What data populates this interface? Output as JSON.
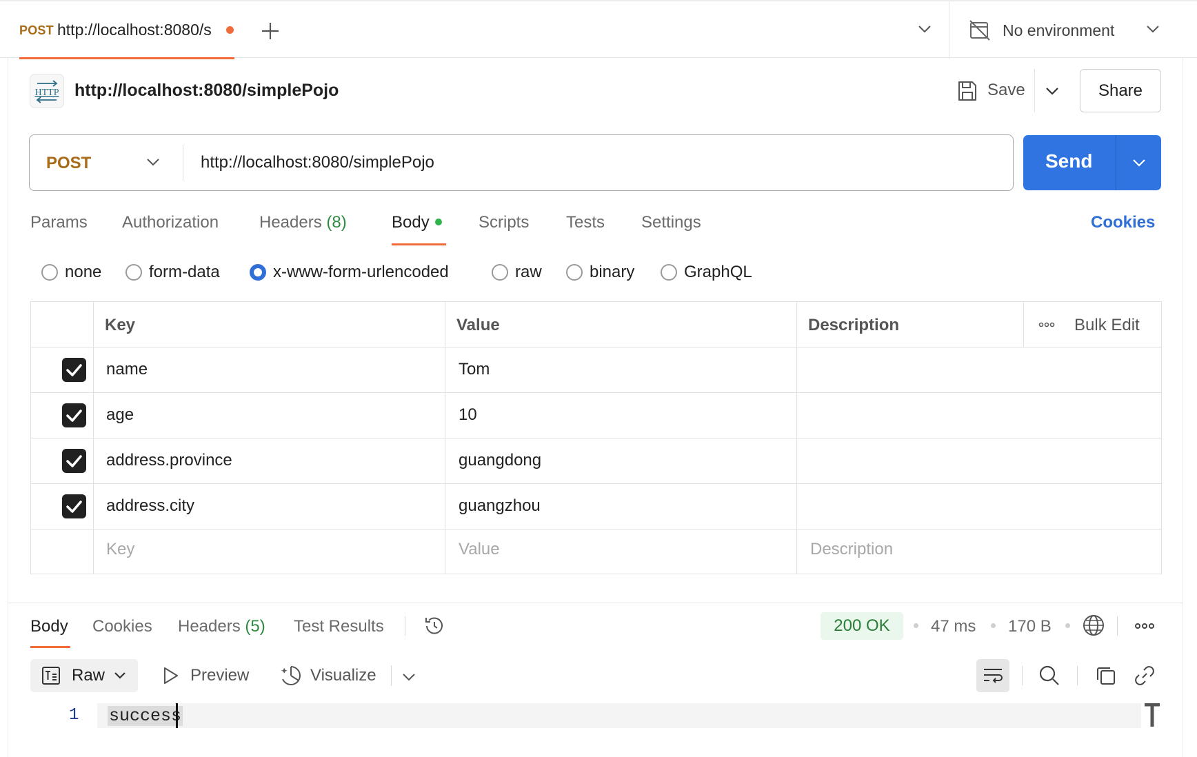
{
  "top_tab": {
    "method": "POST",
    "url": "http://localhost:8080/s",
    "environment": "No environment"
  },
  "request": {
    "title": "http://localhost:8080/simplePojo",
    "save_label": "Save",
    "share_label": "Share",
    "method": "POST",
    "url": "http://localhost:8080/simplePojo",
    "send_label": "Send"
  },
  "request_tabs": [
    {
      "label": "Params",
      "count": ""
    },
    {
      "label": "Authorization",
      "count": ""
    },
    {
      "label": "Headers",
      "count": "(8)"
    },
    {
      "label": "Body",
      "count": ""
    },
    {
      "label": "Scripts",
      "count": ""
    },
    {
      "label": "Tests",
      "count": ""
    },
    {
      "label": "Settings",
      "count": ""
    }
  ],
  "cookies_link": "Cookies",
  "body_types": [
    {
      "label": "none",
      "selected": false
    },
    {
      "label": "form-data",
      "selected": false
    },
    {
      "label": "x-www-form-urlencoded",
      "selected": true
    },
    {
      "label": "raw",
      "selected": false
    },
    {
      "label": "binary",
      "selected": false
    },
    {
      "label": "GraphQL",
      "selected": false
    }
  ],
  "table": {
    "headers": {
      "key": "Key",
      "value": "Value",
      "description": "Description"
    },
    "bulk_edit": "Bulk Edit",
    "rows": [
      {
        "checked": true,
        "key": "name",
        "value": "Tom",
        "description": ""
      },
      {
        "checked": true,
        "key": "age",
        "value": "10",
        "description": ""
      },
      {
        "checked": true,
        "key": "address.province",
        "value": "guangdong",
        "description": ""
      },
      {
        "checked": true,
        "key": "address.city",
        "value": "guangzhou",
        "description": ""
      }
    ],
    "placeholders": {
      "key": "Key",
      "value": "Value",
      "description": "Description"
    }
  },
  "response": {
    "tabs": [
      {
        "label": "Body",
        "count": ""
      },
      {
        "label": "Cookies",
        "count": ""
      },
      {
        "label": "Headers",
        "count": "(5)"
      },
      {
        "label": "Test Results",
        "count": ""
      }
    ],
    "status": "200 OK",
    "time": "47 ms",
    "size": "170 B",
    "format": "Raw",
    "preview_label": "Preview",
    "visualize_label": "Visualize",
    "lines": [
      {
        "number": "1",
        "text": "success"
      }
    ]
  },
  "colors": {
    "accent_orange": "#f26b3a",
    "method_post": "#a96b17",
    "send_blue": "#2f74e0",
    "link_blue": "#2f6fd6",
    "status_green": "#2a7d36"
  }
}
